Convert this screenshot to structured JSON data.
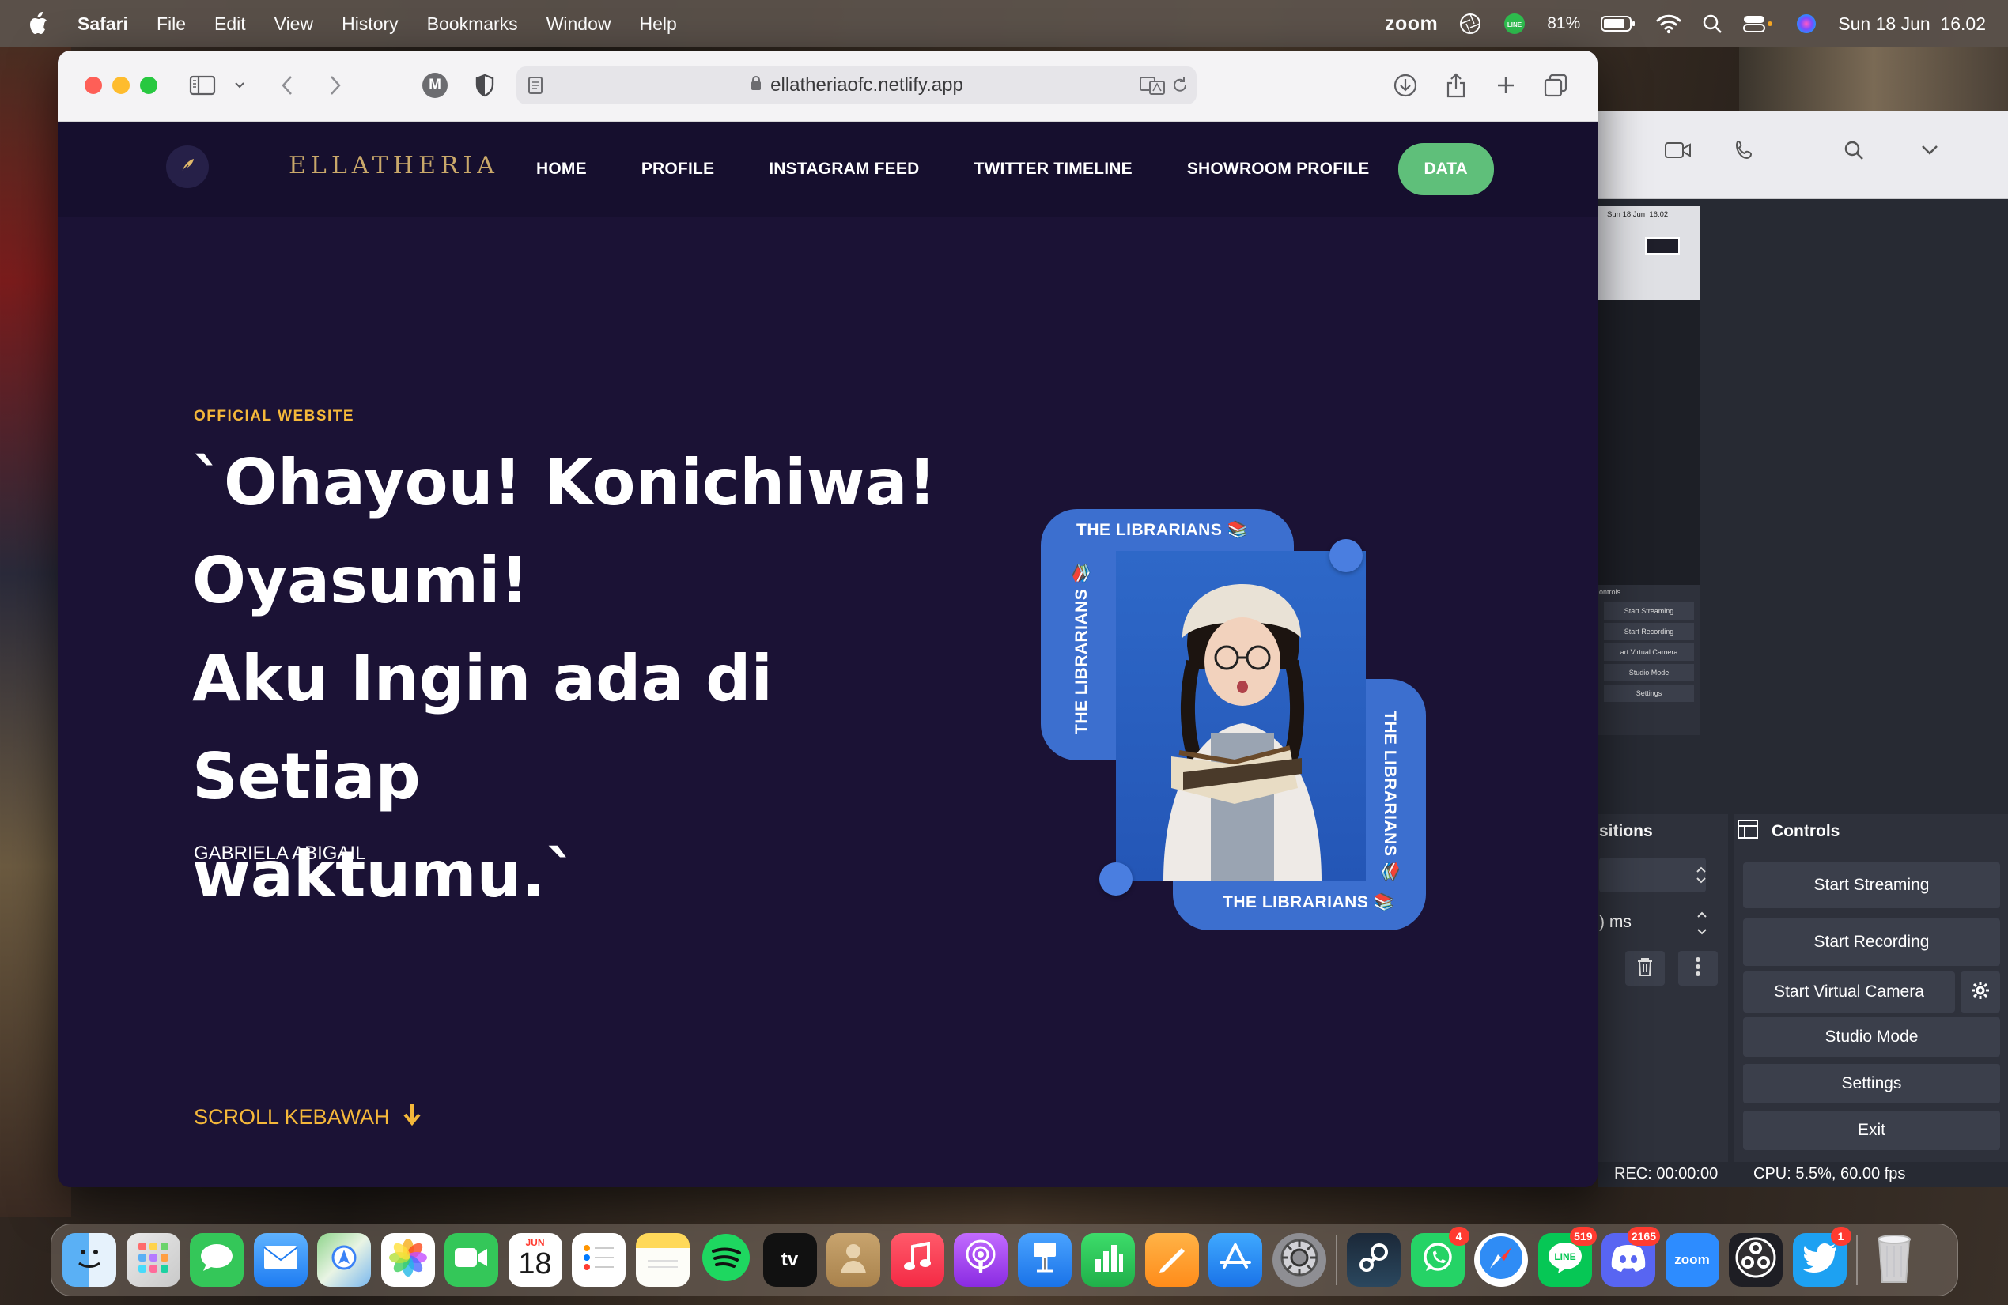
{
  "menubar": {
    "app_name": "Safari",
    "menus": [
      "File",
      "Edit",
      "View",
      "History",
      "Bookmarks",
      "Window",
      "Help"
    ],
    "zoom_label": "zoom",
    "line_label": "LINE",
    "battery": "81%",
    "datetime": "Sun 18 Jun  16.02"
  },
  "browser": {
    "url": "ellatheriaofc.netlify.app",
    "profile_letter": "M"
  },
  "site": {
    "brand": "ELLATHERIA",
    "nav": [
      "HOME",
      "PROFILE",
      "INSTAGRAM FEED",
      "TWITTER TIMELINE",
      "SHOWROOM PROFILE"
    ],
    "nav_cta": "DATA",
    "kicker": "OFFICIAL WEBSITE",
    "headline_lines": [
      "`Ohayou! Konichiwa!",
      "Oyasumi!",
      "Aku Ingin ada di Setiap",
      "waktumu.`"
    ],
    "author": "GABRIELA ABIGAIL",
    "scroll_label": "SCROLL KEBAWAH",
    "hero_label": "THE LIBRARIANS 📚"
  },
  "obs": {
    "panel_transitions": "sitions",
    "panel_controls": "Controls",
    "duration_value": ") ms",
    "buttons": [
      "Start Streaming",
      "Start Recording",
      "Start Virtual Camera",
      "Studio Mode",
      "Settings",
      "Exit"
    ],
    "rec_status": "REC: 00:00:00",
    "cpu_status": "CPU: 5.5%, 60.00 fps",
    "mini_date": "Sun 18 Jun  16.02",
    "mini_controls": "ontrols",
    "mini_items": [
      "Start Streaming",
      "Start Recording",
      "art Virtual Camera",
      "Studio Mode",
      "Settings"
    ]
  },
  "dock": {
    "calendar_month": "JUN",
    "calendar_day": "18",
    "tv_label": "tv",
    "zoom_label": "zoom",
    "line_label": "LINE",
    "badges": {
      "whatsapp": "4",
      "line": "519",
      "discord": "2165",
      "twitter": "1"
    }
  },
  "colors": {
    "page_bg": "#1b1235",
    "accent_yellow": "#f5b83a",
    "cta_green": "#5fbf7a",
    "card_blue": "#3c6fcf"
  }
}
